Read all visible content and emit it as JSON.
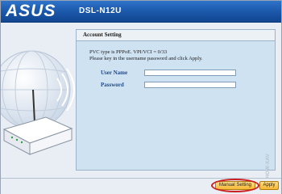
{
  "header": {
    "brand": "ASUS",
    "model": "DSL-N12U"
  },
  "panel": {
    "title": "Account Setting",
    "info_line1": "PVC type is PPPoE. VPI/VCI = 0/33",
    "info_line2": "Please key in the username password and click Apply.",
    "username_label": "User Name",
    "username_value": "",
    "password_label": "Password",
    "password_value": ""
  },
  "footer": {
    "manual_setting_label": "Manual Setting",
    "apply_label": "Apply"
  },
  "watermark": "HOW-XAV",
  "colors": {
    "header_blue": "#1a56a8",
    "panel_bg": "#cfe2f2",
    "label_blue": "#1f4a86",
    "button_yellow": "#f7b733",
    "highlight_red": "#cc1f1f"
  }
}
